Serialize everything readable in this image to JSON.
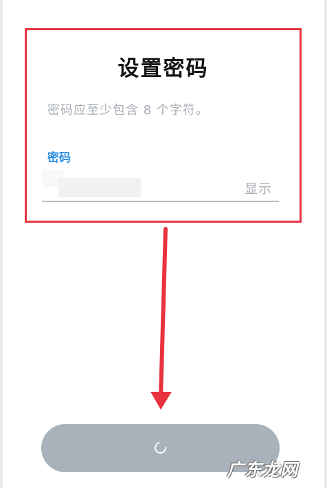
{
  "dialog": {
    "title": "设置密码",
    "hint": "密码应至少包含 8 个字符。",
    "password_label": "密码",
    "password_value": "",
    "show_label": "显示"
  },
  "submit": {
    "state": "loading",
    "button_color": "#a9b2bb"
  },
  "annotation": {
    "highlight_color": "#e8323f",
    "arrow_color": "#e8323f"
  },
  "watermark": {
    "text": "广东龙网"
  }
}
